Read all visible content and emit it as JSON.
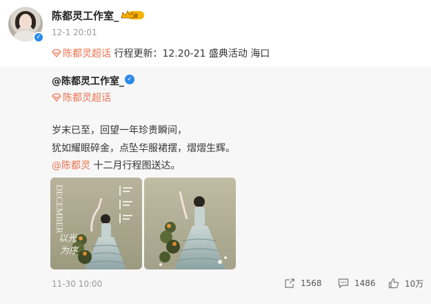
{
  "post": {
    "author_name": "陈都灵工作室_",
    "vip_label": "II",
    "time": "12-1 20:01",
    "topic_link": "陈都灵超话",
    "topic_text": " 行程更新：12.20-21 盛典活动 海口"
  },
  "repost": {
    "author": "@陈都灵工作室_",
    "topic": "陈都灵超话",
    "line1": "岁末已至，回望一年珍贵瞬间，",
    "line2": "犹如耀眼碎金，点坠华服裙摆，熠熠生辉。",
    "mention": "@陈都灵",
    "line3_rest": " 十二月行程图送达。",
    "photo1_title": "DECEMBER",
    "time": "11-30 10:00",
    "reposts": "1568",
    "comments": "1486",
    "likes": "10万"
  },
  "colors": {
    "accent": "#eb7350",
    "verified": "#2b8ae8",
    "muted": "#999999",
    "repost_bg": "#f7f7f7"
  },
  "icons": [
    "verified-icon",
    "vip-crown-icon",
    "supertopic-icon",
    "repost-icon",
    "comment-icon",
    "like-icon"
  ]
}
